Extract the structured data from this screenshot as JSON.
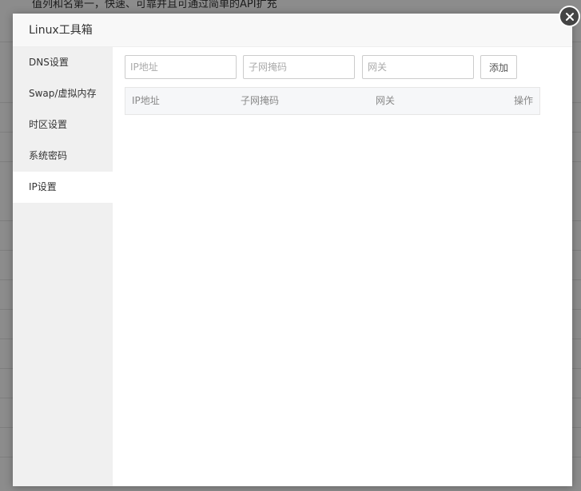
{
  "background": {
    "partial_text": "值列和名第一，快速、可靠并且可通过简单的API扩充"
  },
  "dialog": {
    "title": "Linux工具箱"
  },
  "sidebar": {
    "items": [
      {
        "label": "DNS设置"
      },
      {
        "label": "Swap/虚拟内存"
      },
      {
        "label": "时区设置"
      },
      {
        "label": "系统密码"
      },
      {
        "label": "IP设置"
      }
    ],
    "active_index": 4
  },
  "ip_form": {
    "ip_placeholder": "IP地址",
    "mask_placeholder": "子网掩码",
    "gateway_placeholder": "网关",
    "add_label": "添加"
  },
  "ip_table": {
    "columns": [
      "IP地址",
      "子网掩码",
      "网关",
      "操作"
    ]
  },
  "icons": {
    "close": "close-icon"
  }
}
